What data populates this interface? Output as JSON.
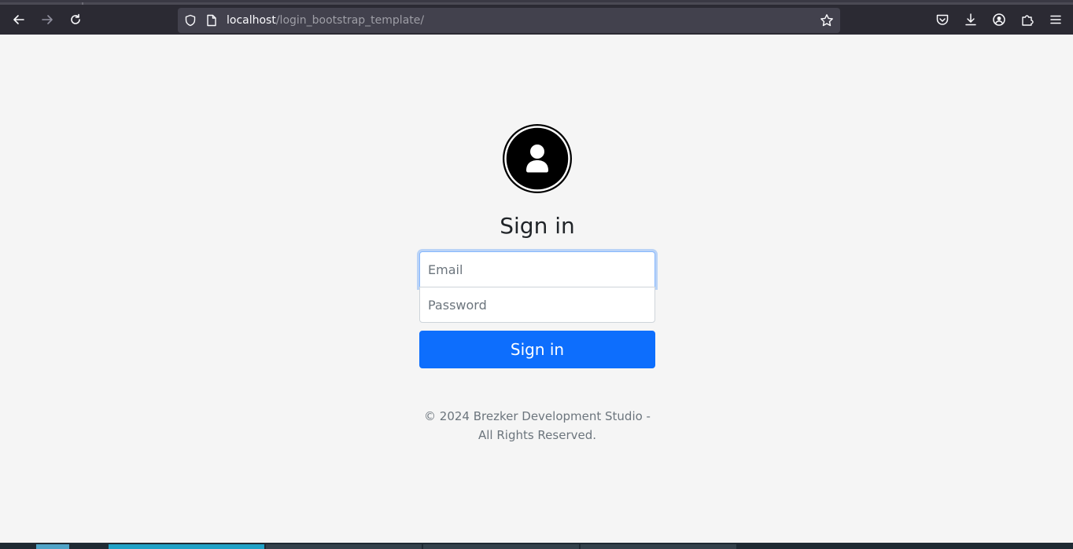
{
  "browser": {
    "url_host": "localhost",
    "url_path": "/login_bootstrap_template/",
    "icons": [
      "back-icon",
      "forward-icon",
      "reload-icon",
      "shield-icon",
      "page-icon",
      "star-icon",
      "pocket-icon",
      "download-icon",
      "account-icon",
      "extensions-icon",
      "menu-icon"
    ]
  },
  "login": {
    "avatar_icon": "user-circle-icon",
    "title": "Sign in",
    "email_placeholder": "Email",
    "password_placeholder": "Password",
    "submit_label": "Sign in",
    "accent_color": "#0d6efd"
  },
  "footer": {
    "line1": "© 2024 Brezker Development Studio -",
    "line2": "All Rights Reserved."
  }
}
